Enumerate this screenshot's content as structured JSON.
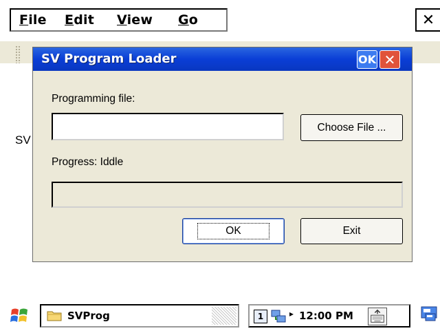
{
  "menu": {
    "items": [
      {
        "label": "File",
        "underline": "F",
        "rest": "ile"
      },
      {
        "label": "Edit",
        "underline": "E",
        "rest": "dit"
      },
      {
        "label": "View",
        "underline": "V",
        "rest": "iew"
      },
      {
        "label": "Go",
        "underline": "G",
        "rest": "o"
      }
    ],
    "close_glyph": "✕"
  },
  "background_text": "SV",
  "dialog": {
    "title": "SV Program Loader",
    "title_ok": "OK",
    "title_close": "✕",
    "file_label": "Programming file:",
    "file_value": "",
    "choose_button": "Choose File ...",
    "progress_label": "Progress: Iddle",
    "progress_value": 0,
    "ok_button": "OK",
    "exit_button": "Exit"
  },
  "taskbar": {
    "task_label": "SVProg",
    "tray_number": "1",
    "tray_arrow": "▸",
    "time": "12:00 PM"
  },
  "icons": {
    "start": "windows-flag-icon",
    "folder": "folder-icon",
    "network": "network-icon",
    "keyboard": "keyboard-icon",
    "desktop": "desktop-icon"
  },
  "colors": {
    "titlebar": "#0a3ed6",
    "dialog_bg": "#ece9d8",
    "close_red": "#e0533a"
  }
}
